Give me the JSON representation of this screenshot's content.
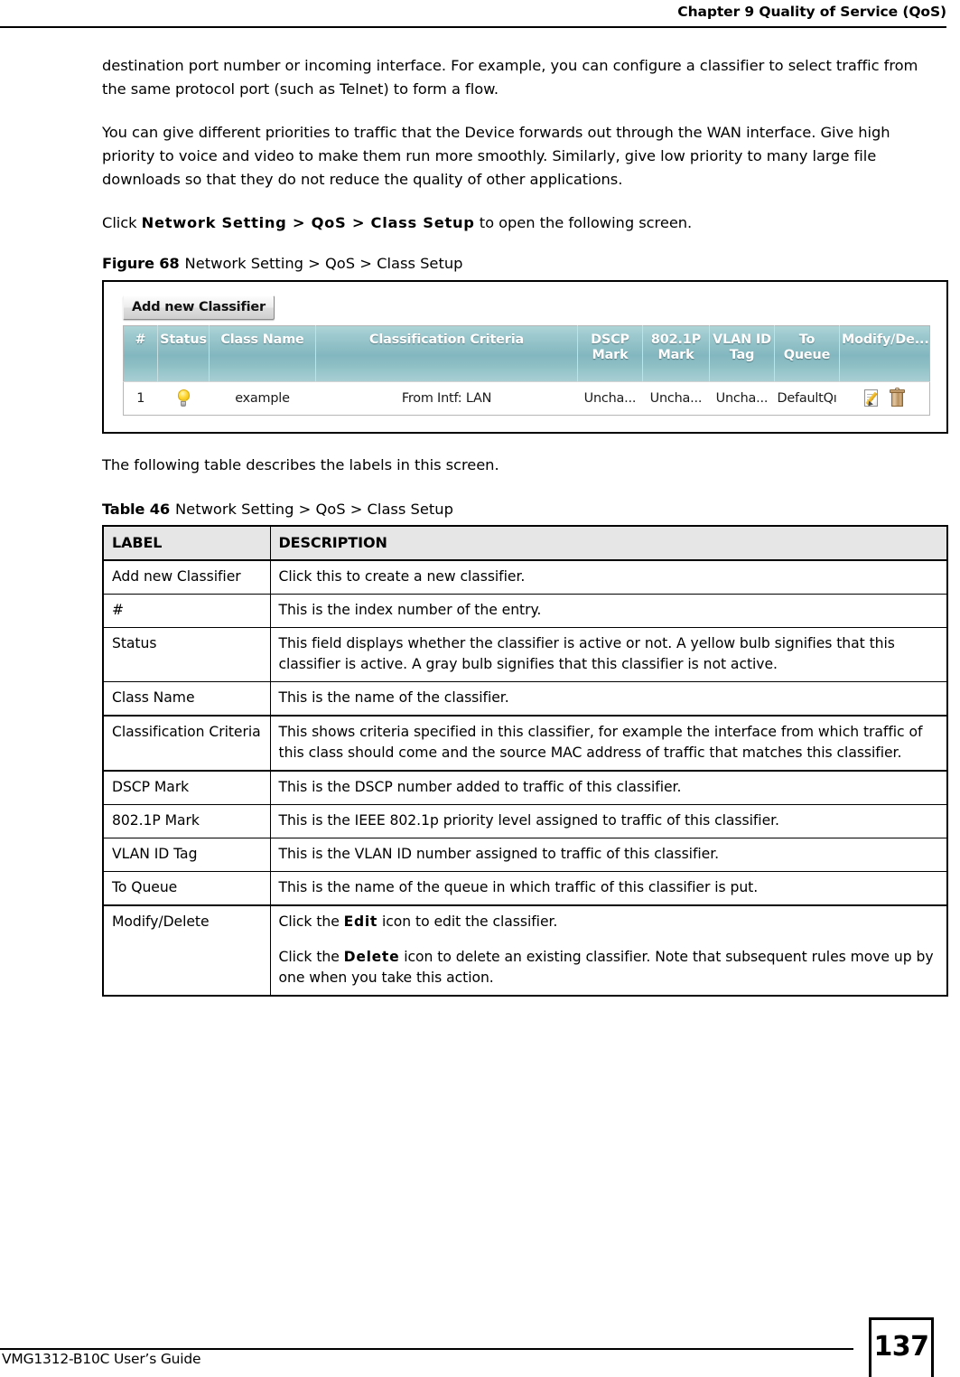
{
  "header": {
    "chapter_title": "Chapter 9 Quality of Service (QoS)"
  },
  "body": {
    "paragraph_1": "destination port number or incoming interface. For example, you can configure a classifier to select traffic from the same protocol port (such as Telnet) to form a flow.",
    "paragraph_2": "You can give different priorities to traffic that the Device forwards out through the WAN interface. Give high priority to voice and video to make them run more smoothly. Similarly, give low priority to many large file downloads so that they do not reduce the quality of other applications.",
    "click_prefix": "Click ",
    "click_path": "Network Setting > QoS > Class Setup",
    "click_suffix": " to open the following screen.",
    "following_table": "The following table describes the labels in this screen."
  },
  "figure": {
    "label": "Figure 68",
    "title": "Network Setting > QoS > Class Setup"
  },
  "screenshot": {
    "add_button": "Add new Classifier",
    "columns": [
      "#",
      "Status",
      "Class Name",
      "Classification Criteria",
      "DSCP\nMark",
      "802.1P\nMark",
      "VLAN ID\nTag",
      "To\nQueue",
      "Modify/De..."
    ],
    "columns_display": {
      "index": "#",
      "status": "Status",
      "class_name": "Class Name",
      "criteria": "Classification Criteria",
      "dscp_line1": "DSCP",
      "dscp_line2": "Mark",
      "dot1p_line1": "802.1P",
      "dot1p_line2": "Mark",
      "vlan_line1": "VLAN ID",
      "vlan_line2": "Tag",
      "queue_line1": "To",
      "queue_line2": "Queue",
      "modify": "Modify/De..."
    },
    "rows": [
      {
        "index": "1",
        "status_icon": "yellow-bulb-icon",
        "class_name": "example",
        "criteria": "From Intf: LAN",
        "dscp_mark": "Uncha...",
        "dot1p_mark": "Uncha...",
        "vlan_id_tag": "Uncha...",
        "to_queue": "DefaultQı",
        "modify_icons": [
          "edit-icon",
          "delete-icon"
        ]
      }
    ],
    "colors": {
      "header_teal_light": "#aed4d7",
      "header_teal_dark": "#83b7bf",
      "bulb_yellow": "#ffd83a",
      "trash_brown": "#b08552",
      "pencil_yellow": "#f0b72a"
    }
  },
  "table46": {
    "label": "Table 46",
    "title": "Network Setting > QoS > Class Setup",
    "headers": {
      "label": "LABEL",
      "description": "DESCRIPTION"
    },
    "rows": [
      {
        "label": "Add new Classifier",
        "description": "Click this to create a new classifier."
      },
      {
        "label": "#",
        "description": "This is the index number of the entry."
      },
      {
        "label": "Status",
        "description": "This field displays whether the classifier is active or not. A yellow bulb signifies that this classifier is active. A gray bulb signifies that this classifier is not active."
      },
      {
        "label": "Class Name",
        "description": "This is the name of the classifier."
      },
      {
        "label": "Classification Criteria",
        "description": "This shows criteria specified in this classifier, for example the interface from which traffic of this class should come and the source MAC address of traffic that matches this classifier."
      },
      {
        "label": "DSCP Mark",
        "description": "This is the DSCP number added to traffic of this classifier."
      },
      {
        "label": "802.1P Mark",
        "description": "This is the IEEE 802.1p priority level assigned to traffic of this classifier."
      },
      {
        "label": "VLAN ID Tag",
        "description": "This is the VLAN ID number assigned to traffic of this classifier."
      },
      {
        "label": "To Queue",
        "description": "This is the name of the queue in which traffic of this classifier is put."
      },
      {
        "label": "Modify/Delete",
        "description_part1_prefix": "Click the ",
        "description_part1_bold": "Edit",
        "description_part1_suffix": " icon to edit the classifier.",
        "description_part2_prefix": "Click the ",
        "description_part2_bold": "Delete",
        "description_part2_suffix": " icon to delete an existing classifier. Note that subsequent rules move up by one when you take this action."
      }
    ]
  },
  "footer": {
    "guide_name": "VMG1312-B10C User’s Guide",
    "page_number": "137"
  }
}
